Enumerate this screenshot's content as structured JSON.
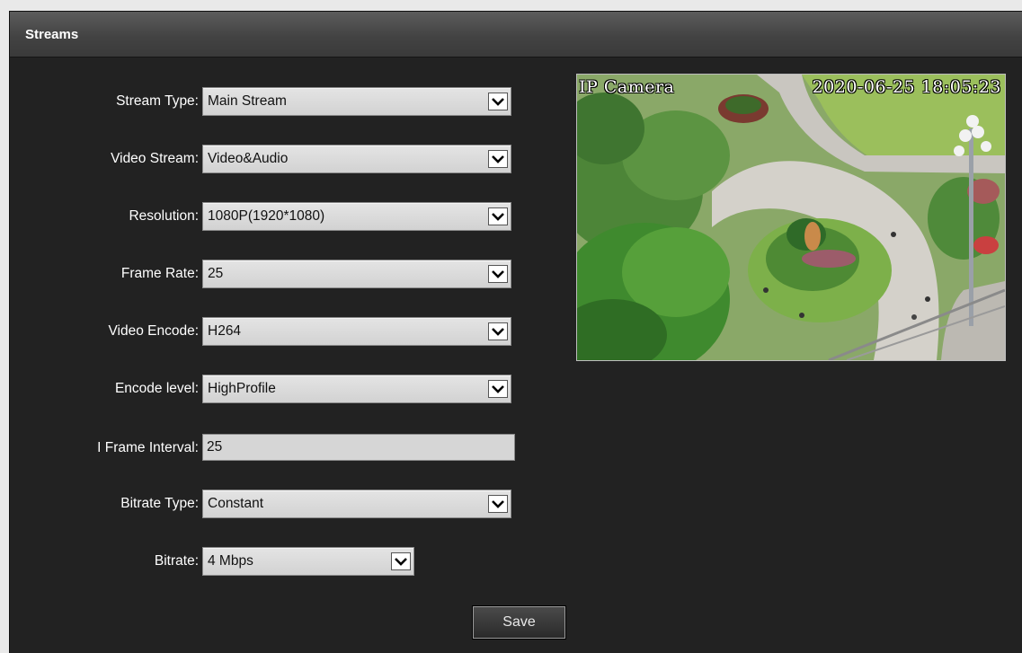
{
  "panel": {
    "title": "Streams"
  },
  "form": {
    "stream_type": {
      "label": "Stream Type:",
      "value": "Main Stream"
    },
    "video_stream": {
      "label": "Video Stream:",
      "value": "Video&Audio"
    },
    "resolution": {
      "label": "Resolution:",
      "value": "1080P(1920*1080)"
    },
    "frame_rate": {
      "label": "Frame Rate:",
      "value": "25"
    },
    "video_encode": {
      "label": "Video Encode:",
      "value": "H264"
    },
    "encode_level": {
      "label": "Encode level:",
      "value": "HighProfile"
    },
    "i_frame": {
      "label": "I Frame Interval:",
      "value": "25"
    },
    "bitrate_type": {
      "label": "Bitrate Type:",
      "value": "Constant"
    },
    "bitrate": {
      "label": "Bitrate:",
      "value": "4 Mbps"
    }
  },
  "actions": {
    "save_label": "Save"
  },
  "preview": {
    "osd_name": "IP Camera",
    "osd_timestamp": "2020-06-25 18:05:23"
  },
  "icons": {
    "dropdown": "chevron-down-icon"
  },
  "colors": {
    "panel_bg": "#222222",
    "header_bg": "#4a4a4a",
    "control_bg": "#d6d6d6"
  }
}
